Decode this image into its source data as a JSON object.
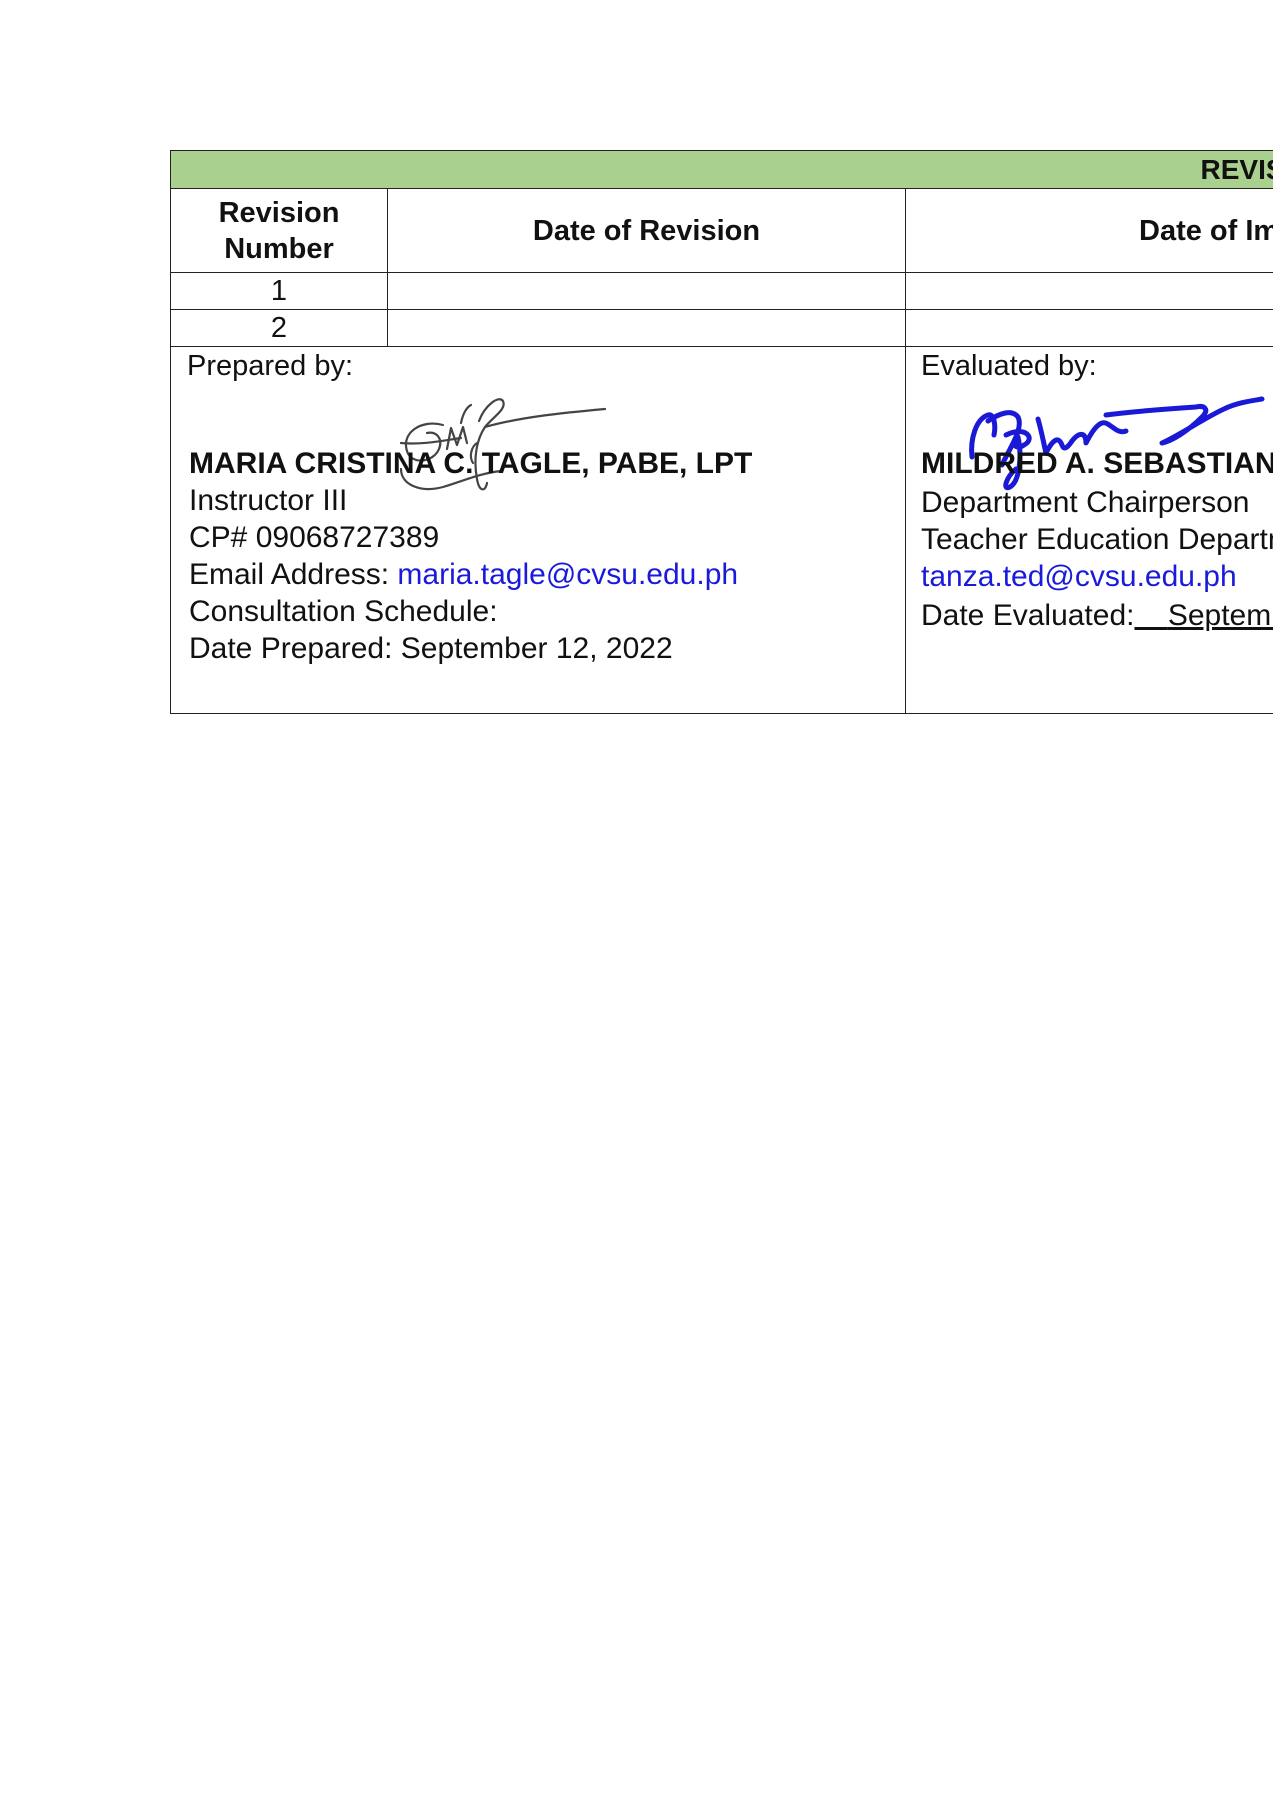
{
  "revision_history": {
    "title": "REVISION HISTORY",
    "columns": [
      "Revision Number",
      "Date of Revision",
      "Date of Implementation"
    ],
    "rows": [
      {
        "number": "1",
        "date_of_revision": "",
        "date_of_implementation": ""
      },
      {
        "number": "2",
        "date_of_revision": "",
        "date_of_implementation": ""
      }
    ]
  },
  "prepared": {
    "label": "Prepared by:",
    "name": "MARIA CRISTINA C. TAGLE, PABE, LPT",
    "position": "Instructor III",
    "cp": "CP# 09068727389",
    "email_label": "Email Address: ",
    "email": "maria.tagle@cvsu.edu.ph",
    "consultation": "Consultation Schedule:",
    "date_prepared": "Date Prepared: September 12, 2022"
  },
  "evaluated": {
    "label": "Evaluated by:",
    "name": "MILDRED A. SEBASTIAN",
    "position": "Department Chairperson",
    "department": "Teacher Education Department",
    "email": "tanza.ted@cvsu.edu.ph",
    "date_label": "Date Evaluated:",
    "date_value": "September"
  },
  "colors": {
    "header_bg": "#a9d08e",
    "email_link": "#1a1adb",
    "signature_blue": "#1a1ad6"
  }
}
